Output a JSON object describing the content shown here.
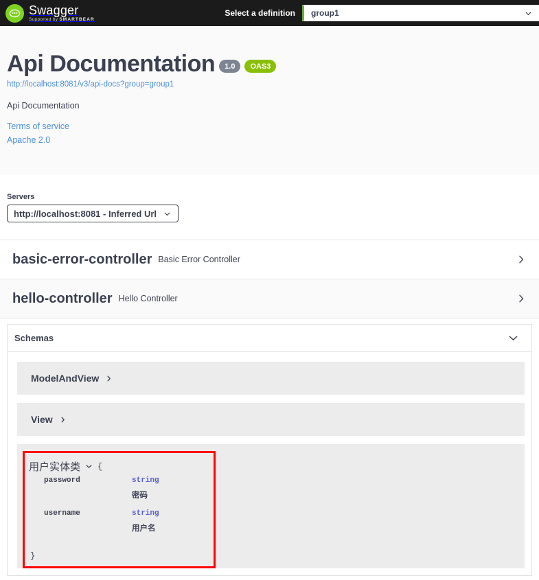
{
  "topbar": {
    "logo_title": "Swagger",
    "logo_suffix": ".",
    "logo_supported_prefix": "Supported by ",
    "logo_supported_brand": "SMARTBEAR",
    "select_definition_label": "Select a definition",
    "definition_value": "group1",
    "definition_options": [
      "group1"
    ],
    "background_color": "#1b1b1b",
    "logo_color": "#7ed321",
    "select_accent_color": "#6aab3c"
  },
  "info": {
    "title": "Api Documentation",
    "version_badge": "1.0",
    "spec_badge": "OAS3",
    "docs_url": "http://localhost:8081/v3/api-docs?group=group1",
    "description": "Api Documentation",
    "terms_link": "Terms of service",
    "license_link": "Apache 2.0",
    "version_badge_color": "#7d8492",
    "spec_badge_color": "#89bf04",
    "link_color": "#4990e2"
  },
  "servers": {
    "label": "Servers",
    "selected": "http://localhost:8081 - Inferred Url",
    "options": [
      "http://localhost:8081 - Inferred Url"
    ]
  },
  "tags": [
    {
      "name": "basic-error-controller",
      "description": "Basic Error Controller",
      "expand_icon": "chevron-right-icon",
      "shaded": false
    },
    {
      "name": "hello-controller",
      "description": "Hello Controller",
      "expand_icon": "chevron-right-icon",
      "shaded": true
    }
  ],
  "schemas": {
    "title": "Schemas",
    "collapse_icon": "chevron-down-icon",
    "models": [
      {
        "name": "ModelAndView",
        "expanded": false,
        "expand_icon": "chevron-right-icon"
      },
      {
        "name": "View",
        "expanded": false,
        "expand_icon": "chevron-right-icon"
      },
      {
        "name": "用户实体类",
        "expanded": true,
        "expand_icon": "chevron-down-icon",
        "highlighted": true,
        "highlight_color": "#ff0000",
        "open_brace": "{",
        "close_brace": "}",
        "properties": [
          {
            "name": "password",
            "type": "string",
            "description": "密码"
          },
          {
            "name": "username",
            "type": "string",
            "description": "用户名"
          }
        ]
      }
    ],
    "type_color": "#5b5bd6"
  }
}
